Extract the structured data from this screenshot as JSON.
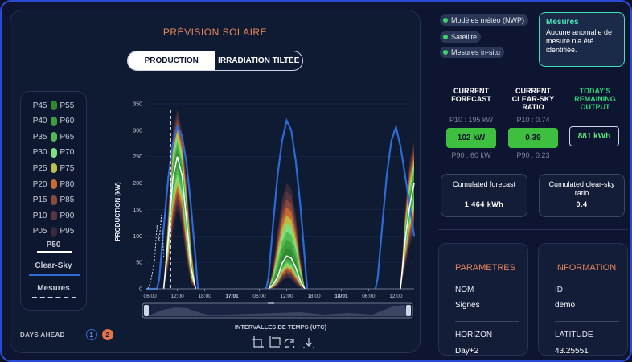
{
  "main": {
    "title": "PRÉVISION SOLAIRE",
    "toggle": {
      "production": "PRODUCTION",
      "irradiation": "IRRADIATION TILTÉE"
    }
  },
  "legend": {
    "rows": [
      {
        "left": "P45",
        "right": "P55",
        "color": "#2f8a2f"
      },
      {
        "left": "P40",
        "right": "P60",
        "color": "#3a9f3a"
      },
      {
        "left": "P35",
        "right": "P65",
        "color": "#52b852"
      },
      {
        "left": "P30",
        "right": "P70",
        "color": "#7fe07f"
      },
      {
        "left": "P25",
        "right": "P75",
        "color": "#b9bf4b"
      },
      {
        "left": "P20",
        "right": "P80",
        "color": "#c96b2f"
      },
      {
        "left": "P15",
        "right": "P85",
        "color": "#8c4a3a"
      },
      {
        "left": "P10",
        "right": "P90",
        "color": "#5a3440"
      },
      {
        "left": "P05",
        "right": "P95",
        "color": "#3a2a3a"
      }
    ],
    "p50": "P50",
    "clearsky": "Clear-Sky",
    "mesures": "Mesures"
  },
  "days_ahead": {
    "label": "DAYS AHEAD",
    "opt1": "1",
    "opt2": "2"
  },
  "chart_data": {
    "type": "area",
    "ylabel": "PRODUCTION (kW)",
    "xlabel": "INTERVALLES DE TEMPS (UTC)",
    "ylim": [
      0,
      350
    ],
    "yticks": [
      0,
      50,
      100,
      150,
      200,
      250,
      300,
      350
    ],
    "xticks": [
      "06:00",
      "12:00",
      "18:00",
      "17/01",
      "06:00",
      "12:00",
      "18:00",
      "18/01",
      "06:00",
      "12:00"
    ],
    "xtick_hours": [
      6,
      12,
      18,
      24,
      30,
      36,
      42,
      48,
      54,
      60
    ],
    "xlim_hours": [
      5,
      64
    ],
    "series": [
      {
        "name": "Clear-Sky",
        "x": [
          5,
          7.5,
          8,
          9,
          10,
          11,
          12,
          13,
          14,
          15,
          16,
          16.5,
          31.5,
          32,
          33,
          34,
          35,
          36,
          37,
          38,
          39,
          40,
          40.5,
          55.5,
          56,
          57,
          58,
          59,
          60,
          61,
          62,
          63,
          64
        ],
        "y": [
          0,
          0,
          18,
          115,
          210,
          275,
          306,
          290,
          238,
          155,
          55,
          0,
          0,
          20,
          120,
          215,
          280,
          318,
          300,
          242,
          158,
          55,
          0,
          0,
          20,
          120,
          215,
          280,
          306,
          270,
          215,
          160,
          100
        ]
      },
      {
        "name": "P50",
        "x": [
          9,
          10,
          11,
          12,
          13,
          14,
          15,
          16,
          32,
          33,
          34,
          35,
          36,
          37,
          38,
          39,
          40,
          61,
          62,
          63,
          64
        ],
        "y": [
          0,
          95,
          210,
          250,
          215,
          130,
          40,
          0,
          0,
          8,
          22,
          48,
          62,
          58,
          40,
          15,
          0,
          0,
          90,
          155,
          200
        ]
      }
    ],
    "bands": {
      "x": [
        9,
        10,
        11,
        12,
        13,
        14,
        15,
        16,
        32,
        33,
        34,
        35,
        36,
        37,
        38,
        39,
        40,
        61,
        62,
        63,
        64
      ],
      "p05": [
        0,
        40,
        110,
        150,
        120,
        55,
        10,
        0,
        0,
        0,
        5,
        15,
        22,
        18,
        8,
        2,
        0,
        0,
        40,
        80,
        110
      ],
      "p95": [
        0,
        150,
        300,
        340,
        300,
        210,
        90,
        0,
        0,
        40,
        110,
        170,
        200,
        190,
        140,
        60,
        0,
        0,
        150,
        240,
        280
      ]
    },
    "mesures": {
      "x": [
        5.5,
        6,
        6.5,
        7,
        7.5,
        8,
        8.5,
        9
      ],
      "y": [
        0,
        10,
        30,
        55,
        120,
        90,
        140,
        60
      ]
    },
    "now_marker_hour": 10.5
  },
  "sources": {
    "nwp": "Modèles météo (NWP)",
    "satellite": "Satellite",
    "insitu": "Mesures in-situ"
  },
  "mesures_box": {
    "title": "Mesures",
    "text": "Aucune anomalie de mesure n'a été identifiée."
  },
  "kpis": {
    "forecast": {
      "title_1": "CURRENT",
      "title_2": "FORECAST",
      "p10": "P10 : 195 kW",
      "value": "102 kW",
      "p90": "P90 : 60 kW"
    },
    "ratio": {
      "title_1": "CURRENT",
      "title_2": "CLEAR-SKY",
      "title_3": "RATIO",
      "p10": "P10 : 0.74",
      "value": "0.39",
      "p90": "P90 : 0.23"
    },
    "remaining": {
      "title_1": "TODAY'S",
      "title_2": "REMAINING",
      "title_3": "OUTPUT",
      "value": "881 kWh"
    }
  },
  "cumulated": {
    "forecast": {
      "title": "Cumulated forecast",
      "value": "1 464 kWh"
    },
    "ratio": {
      "title_1": "Cumulated clear-sky",
      "title_2": "ratio",
      "value": "0.4"
    }
  },
  "parametres": {
    "title": "PARAMETRES",
    "nom_label": "NOM",
    "nom_value": "Signes",
    "horizon_label": "HORIZON",
    "horizon_value": "Day+2"
  },
  "information": {
    "title": "INFORMATION",
    "id_label": "ID",
    "id_value": "demo",
    "lat_label": "LATITUDE",
    "lat_value": "43.25551"
  }
}
